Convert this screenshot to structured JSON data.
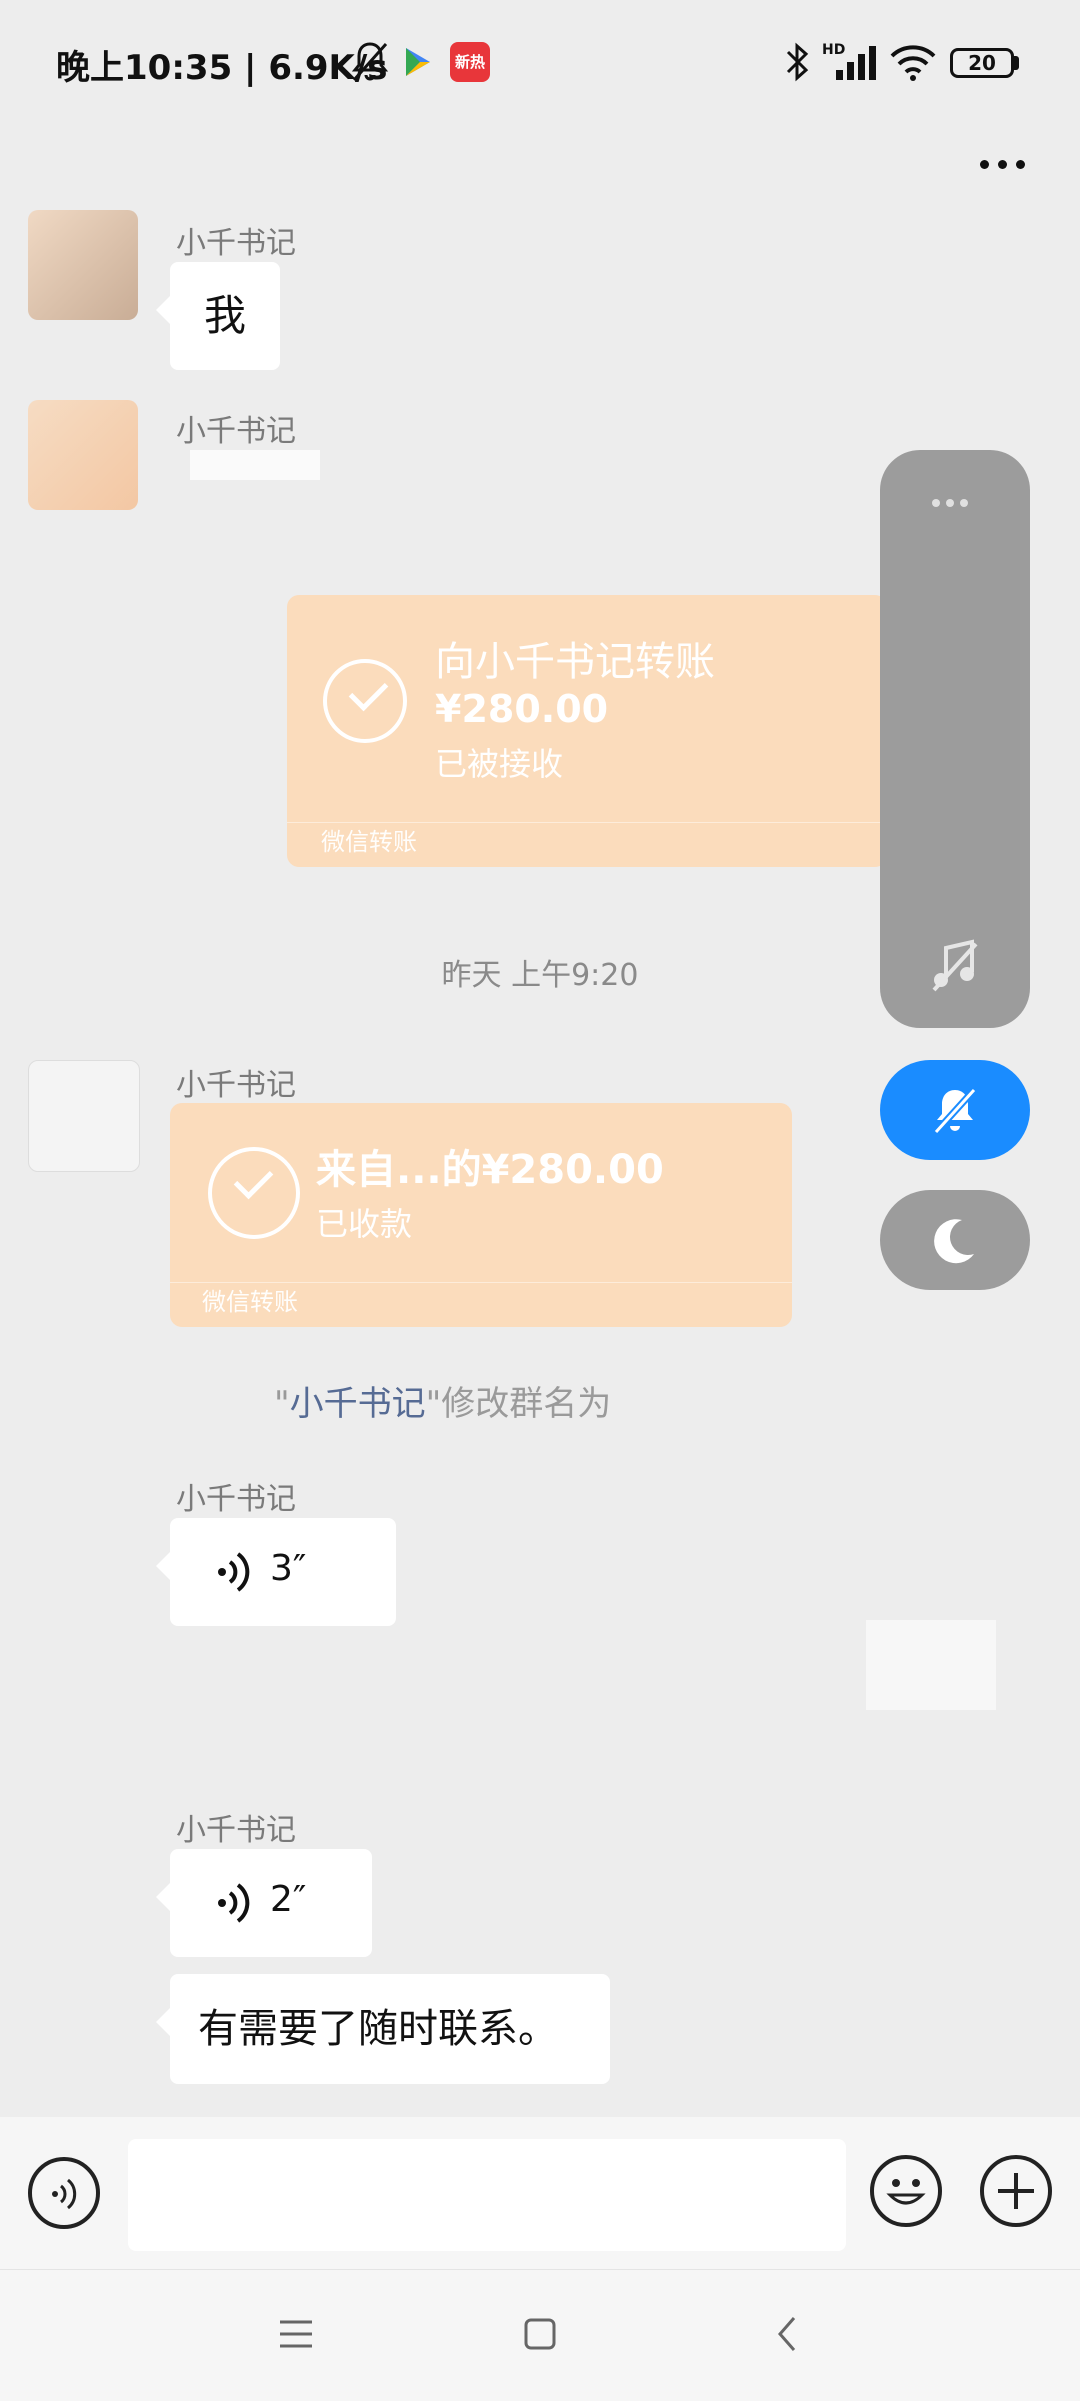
{
  "status_bar": {
    "time_speed": "晚上10:35 | 6.9K/s",
    "battery": "20",
    "network_badge": "HD",
    "news_badge": "新热",
    "icons": [
      "bell-off-icon",
      "play-store-icon",
      "news-app-icon",
      "bluetooth-icon",
      "signal-icon",
      "wifi-icon",
      "battery-icon"
    ]
  },
  "title_bar": {
    "title": "",
    "more_label": "more-menu"
  },
  "messages": [
    {
      "sender": "小千书记",
      "text": "我"
    },
    {
      "sender": "小千书记"
    },
    {
      "transfer_out": {
        "title": "向小千书记转账",
        "amount": "¥280.00",
        "status": "已被接收",
        "footer": "微信转账"
      }
    },
    {
      "timestamp": "昨天 上午9:20"
    },
    {
      "sender": "小千书记",
      "transfer_in": {
        "title": "来自...的¥280.00",
        "status": "已收款",
        "footer": "微信转账"
      }
    },
    {
      "system": {
        "quote_open": "\"",
        "name": "小千书记",
        "quote_close": "\"",
        "text": "修改群名为"
      }
    },
    {
      "sender": "小千书记",
      "voice_duration": "3″"
    },
    {
      "sender": "小千书记",
      "voice_duration": "2″"
    },
    {
      "text": "有需要了随时联系。"
    }
  ],
  "float_panel": {
    "icons": [
      "more-dots-icon",
      "music-off-icon",
      "bell-off-icon",
      "moon-icon"
    ],
    "accent": "#1a8cff"
  },
  "input_bar": {
    "placeholder": "",
    "icons": [
      "voice-icon",
      "emoji-icon",
      "plus-icon"
    ]
  },
  "nav_bar": {
    "icons": [
      "menu-icon",
      "home-icon",
      "back-icon"
    ]
  },
  "colors": {
    "background": "#ededed",
    "transfer": "#fbdcbc",
    "accent_blue": "#1a8cff",
    "name_link": "#566b94"
  }
}
